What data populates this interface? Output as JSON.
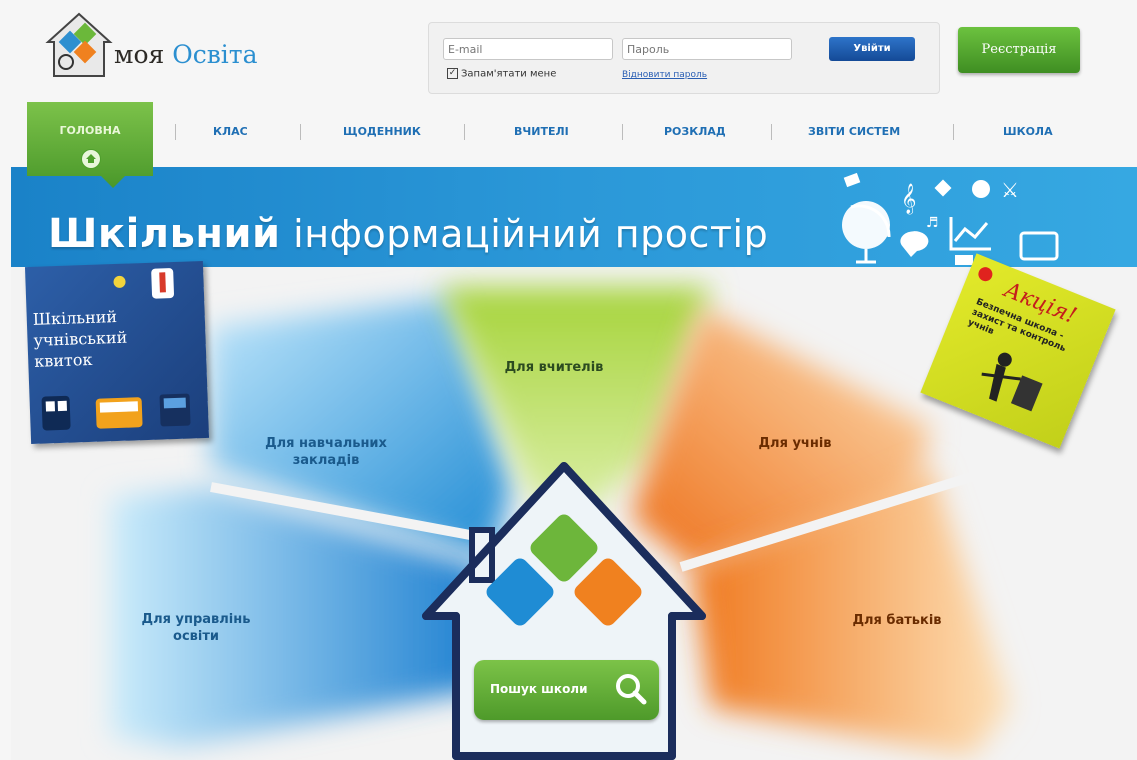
{
  "brand": {
    "logo_text_1": "моя ",
    "logo_text_2": "Освіта"
  },
  "login": {
    "email_placeholder": "E-mail",
    "password_placeholder": "Пароль",
    "remember_label": "Запам'ятати мене",
    "forgot_link": "Відновити пароль",
    "login_button": "Увійти",
    "register_button": "Реєстрація"
  },
  "nav": {
    "items": [
      {
        "label": "ГОЛОВНА"
      },
      {
        "label": "КЛАС"
      },
      {
        "label": "ЩОДЕННИК"
      },
      {
        "label": "ВЧИТЕЛІ"
      },
      {
        "label": "РОЗКЛАД"
      },
      {
        "label": "ЗВІТИ СИСТЕМ"
      },
      {
        "label": "ШКОЛА"
      }
    ]
  },
  "banner": {
    "title_bold": "Шкільний",
    "title_rest": " інформаційний простір"
  },
  "sections": [
    {
      "label": "Для вчителів"
    },
    {
      "label": "Для навчальних закладів"
    },
    {
      "label": "Для учнів"
    },
    {
      "label": "Для управлінь освіти"
    },
    {
      "label": "Для батьків"
    }
  ],
  "ticket": {
    "text": "Шкільний\nучнівський\nквиток"
  },
  "promo": {
    "title": "Акція!",
    "text": "Безпечна школа -\nзахист та контроль\nучнів"
  },
  "search": {
    "label": "Пошук школи"
  },
  "colors": {
    "brand_blue": "#1f6fb4",
    "brand_green": "#5aa832",
    "orange": "#f08a24"
  }
}
